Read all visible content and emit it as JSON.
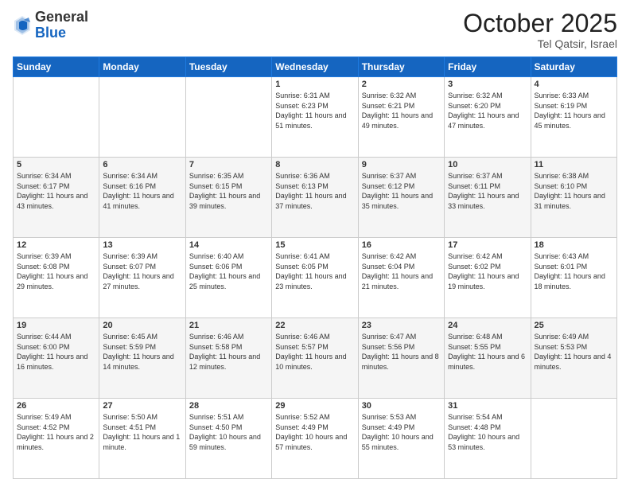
{
  "header": {
    "logo_general": "General",
    "logo_blue": "Blue",
    "month": "October 2025",
    "location": "Tel Qatsir, Israel"
  },
  "days_of_week": [
    "Sunday",
    "Monday",
    "Tuesday",
    "Wednesday",
    "Thursday",
    "Friday",
    "Saturday"
  ],
  "weeks": [
    [
      {
        "day": "",
        "info": ""
      },
      {
        "day": "",
        "info": ""
      },
      {
        "day": "",
        "info": ""
      },
      {
        "day": "1",
        "info": "Sunrise: 6:31 AM\nSunset: 6:23 PM\nDaylight: 11 hours\nand 51 minutes."
      },
      {
        "day": "2",
        "info": "Sunrise: 6:32 AM\nSunset: 6:21 PM\nDaylight: 11 hours\nand 49 minutes."
      },
      {
        "day": "3",
        "info": "Sunrise: 6:32 AM\nSunset: 6:20 PM\nDaylight: 11 hours\nand 47 minutes."
      },
      {
        "day": "4",
        "info": "Sunrise: 6:33 AM\nSunset: 6:19 PM\nDaylight: 11 hours\nand 45 minutes."
      }
    ],
    [
      {
        "day": "5",
        "info": "Sunrise: 6:34 AM\nSunset: 6:17 PM\nDaylight: 11 hours\nand 43 minutes."
      },
      {
        "day": "6",
        "info": "Sunrise: 6:34 AM\nSunset: 6:16 PM\nDaylight: 11 hours\nand 41 minutes."
      },
      {
        "day": "7",
        "info": "Sunrise: 6:35 AM\nSunset: 6:15 PM\nDaylight: 11 hours\nand 39 minutes."
      },
      {
        "day": "8",
        "info": "Sunrise: 6:36 AM\nSunset: 6:13 PM\nDaylight: 11 hours\nand 37 minutes."
      },
      {
        "day": "9",
        "info": "Sunrise: 6:37 AM\nSunset: 6:12 PM\nDaylight: 11 hours\nand 35 minutes."
      },
      {
        "day": "10",
        "info": "Sunrise: 6:37 AM\nSunset: 6:11 PM\nDaylight: 11 hours\nand 33 minutes."
      },
      {
        "day": "11",
        "info": "Sunrise: 6:38 AM\nSunset: 6:10 PM\nDaylight: 11 hours\nand 31 minutes."
      }
    ],
    [
      {
        "day": "12",
        "info": "Sunrise: 6:39 AM\nSunset: 6:08 PM\nDaylight: 11 hours\nand 29 minutes."
      },
      {
        "day": "13",
        "info": "Sunrise: 6:39 AM\nSunset: 6:07 PM\nDaylight: 11 hours\nand 27 minutes."
      },
      {
        "day": "14",
        "info": "Sunrise: 6:40 AM\nSunset: 6:06 PM\nDaylight: 11 hours\nand 25 minutes."
      },
      {
        "day": "15",
        "info": "Sunrise: 6:41 AM\nSunset: 6:05 PM\nDaylight: 11 hours\nand 23 minutes."
      },
      {
        "day": "16",
        "info": "Sunrise: 6:42 AM\nSunset: 6:04 PM\nDaylight: 11 hours\nand 21 minutes."
      },
      {
        "day": "17",
        "info": "Sunrise: 6:42 AM\nSunset: 6:02 PM\nDaylight: 11 hours\nand 19 minutes."
      },
      {
        "day": "18",
        "info": "Sunrise: 6:43 AM\nSunset: 6:01 PM\nDaylight: 11 hours\nand 18 minutes."
      }
    ],
    [
      {
        "day": "19",
        "info": "Sunrise: 6:44 AM\nSunset: 6:00 PM\nDaylight: 11 hours\nand 16 minutes."
      },
      {
        "day": "20",
        "info": "Sunrise: 6:45 AM\nSunset: 5:59 PM\nDaylight: 11 hours\nand 14 minutes."
      },
      {
        "day": "21",
        "info": "Sunrise: 6:46 AM\nSunset: 5:58 PM\nDaylight: 11 hours\nand 12 minutes."
      },
      {
        "day": "22",
        "info": "Sunrise: 6:46 AM\nSunset: 5:57 PM\nDaylight: 11 hours\nand 10 minutes."
      },
      {
        "day": "23",
        "info": "Sunrise: 6:47 AM\nSunset: 5:56 PM\nDaylight: 11 hours\nand 8 minutes."
      },
      {
        "day": "24",
        "info": "Sunrise: 6:48 AM\nSunset: 5:55 PM\nDaylight: 11 hours\nand 6 minutes."
      },
      {
        "day": "25",
        "info": "Sunrise: 6:49 AM\nSunset: 5:53 PM\nDaylight: 11 hours\nand 4 minutes."
      }
    ],
    [
      {
        "day": "26",
        "info": "Sunrise: 5:49 AM\nSunset: 4:52 PM\nDaylight: 11 hours\nand 2 minutes."
      },
      {
        "day": "27",
        "info": "Sunrise: 5:50 AM\nSunset: 4:51 PM\nDaylight: 11 hours\nand 1 minute."
      },
      {
        "day": "28",
        "info": "Sunrise: 5:51 AM\nSunset: 4:50 PM\nDaylight: 10 hours\nand 59 minutes."
      },
      {
        "day": "29",
        "info": "Sunrise: 5:52 AM\nSunset: 4:49 PM\nDaylight: 10 hours\nand 57 minutes."
      },
      {
        "day": "30",
        "info": "Sunrise: 5:53 AM\nSunset: 4:49 PM\nDaylight: 10 hours\nand 55 minutes."
      },
      {
        "day": "31",
        "info": "Sunrise: 5:54 AM\nSunset: 4:48 PM\nDaylight: 10 hours\nand 53 minutes."
      },
      {
        "day": "",
        "info": ""
      }
    ]
  ]
}
